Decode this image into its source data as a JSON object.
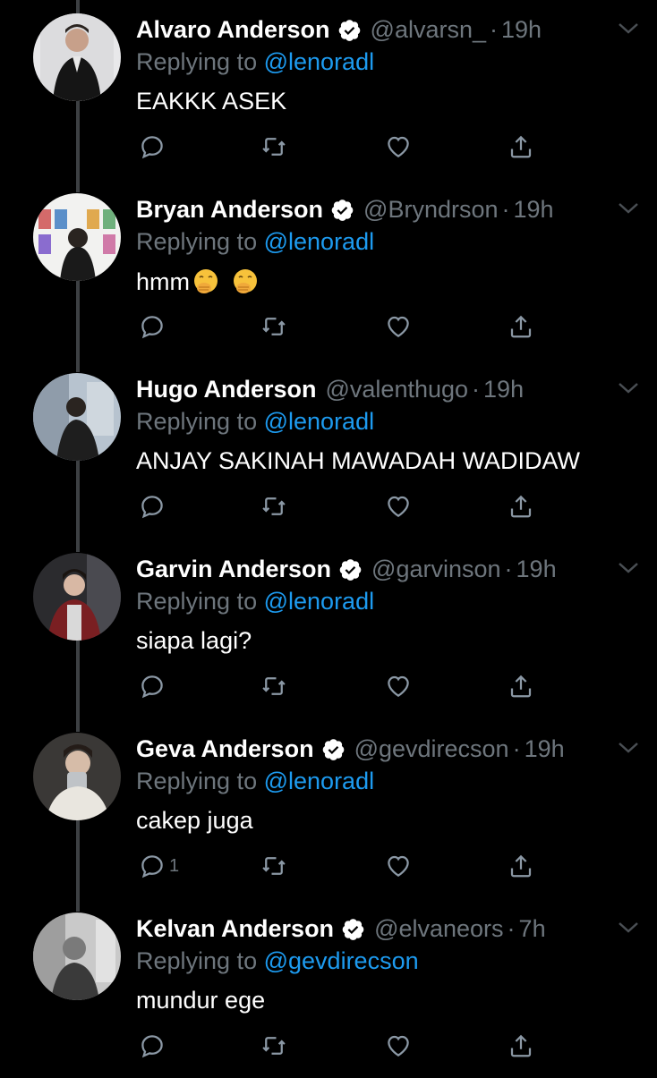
{
  "colors": {
    "background": "#000000",
    "text": "#ffffff",
    "muted": "#6e767d",
    "accent": "#1d9bf0",
    "thread_line": "#3d4043"
  },
  "replying_prefix": "Replying to",
  "tweets": [
    {
      "name": "Alvaro Anderson",
      "verified": true,
      "handle": "@alvarsn_",
      "time": "19h",
      "reply_to": "@lenoradl",
      "text": "EAKKK ASEK",
      "emojis": [],
      "reply_count": ""
    },
    {
      "name": "Bryan Anderson",
      "verified": true,
      "handle": "@Bryndrson",
      "time": "19h",
      "reply_to": "@lenoradl",
      "text": "hmm",
      "emojis": [
        "face-with-hand-over-mouth",
        "face-with-hand-over-mouth"
      ],
      "reply_count": ""
    },
    {
      "name": "Hugo Anderson",
      "verified": false,
      "handle": "@valenthugo",
      "time": "19h",
      "reply_to": "@lenoradl",
      "text": "ANJAY SAKINAH MAWADAH WADIDAW",
      "emojis": [],
      "reply_count": ""
    },
    {
      "name": "Garvin Anderson",
      "verified": true,
      "handle": "@garvinson",
      "time": "19h",
      "reply_to": "@lenoradl",
      "text": "siapa lagi?",
      "emojis": [],
      "reply_count": ""
    },
    {
      "name": "Geva Anderson",
      "verified": true,
      "handle": "@gevdirecson",
      "time": "19h",
      "reply_to": "@lenoradl",
      "text": "cakep juga",
      "emojis": [],
      "reply_count": "1"
    },
    {
      "name": "Kelvan Anderson",
      "verified": true,
      "handle": "@elvaneors",
      "time": "7h",
      "reply_to": "@gevdirecson",
      "text": "mundur ege",
      "emojis": [],
      "reply_count": ""
    }
  ]
}
